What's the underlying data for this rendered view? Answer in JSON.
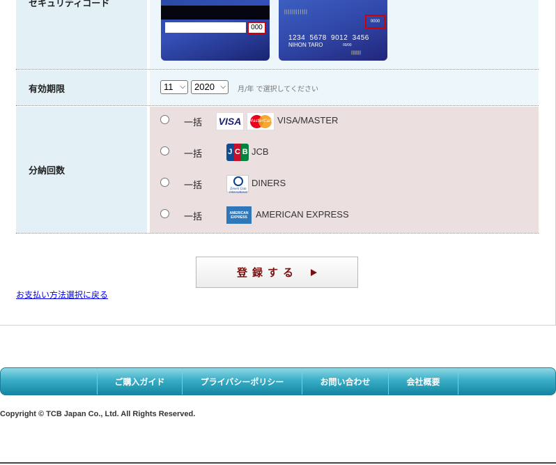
{
  "form": {
    "security_code": {
      "label": "セキュリティコード",
      "card_back": {
        "code": "000"
      },
      "card_front": {
        "dots": "||||||||||||",
        "code": "0000",
        "number": "1234 5678 9012 3456",
        "name": "NIHON TARO",
        "expiry": "00/00",
        "dots2": "|||||||||"
      }
    },
    "expiry": {
      "label": "有効期限",
      "month": "11",
      "year": "2020",
      "hint": "月/年 で選択してください"
    },
    "installments": {
      "label": "分納回数",
      "options": [
        {
          "payment": "一括",
          "brand": "VISA/MASTER",
          "logo_visa": "VISA",
          "logo_mc": "MasterCard"
        },
        {
          "payment": "一括",
          "brand": "JCB",
          "logo": "JCB"
        },
        {
          "payment": "一括",
          "brand": "DINERS",
          "logo": "Diners Club International"
        },
        {
          "payment": "一括",
          "brand": "AMERICAN EXPRESS",
          "logo": "AMERICAN EXPRESS"
        }
      ]
    }
  },
  "submit_label": "登録する",
  "back_link": "お支払い方法選択に戻る",
  "footer": {
    "nav": [
      "ご購入ガイド",
      "プライバシーポリシー",
      "お問い合わせ",
      "会社概要"
    ],
    "copyright": "Copyright © TCB Japan Co., Ltd. All Rights Reserved."
  },
  "colors": {
    "label_bg": "#e3f1f7",
    "field_bg": "#edf6fa",
    "installment_bg": "#ecdfdf",
    "submit_text": "#7a1010",
    "nav_bg": "#3aaec6"
  }
}
